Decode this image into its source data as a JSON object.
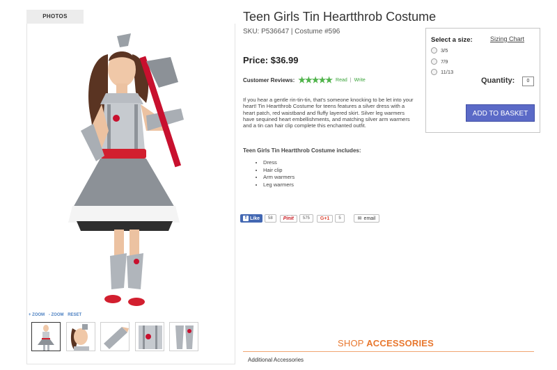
{
  "photos_tab": "PHOTOS",
  "zoom_controls": [
    "+ ZOOM",
    "- ZOOM",
    "RESET"
  ],
  "product": {
    "title": "Teen Girls Tin Heartthrob Costume",
    "sku": "SKU: P536647  |  Costume #596",
    "price": "Price: $36.99",
    "reviews_label": "Customer Reviews:",
    "stars": "★★★★★",
    "read": "Read",
    "write": "Write",
    "description": "If you hear a gentle rin-tin-tin, that's someone knocking to be let into your heart! Tin Heartthrob Costume for teens features a silver dress with a heart patch, red waistband and fluffy layered skirt. Silver leg warmers have sequined heart embellishments, and matching silver arm warmers and a tin can hair clip complete this enchanted outfit.",
    "includes_title": "Teen Girls Tin Heartthrob Costume includes:",
    "includes": [
      "Dress",
      "Hair clip",
      "Arm warmers",
      "Leg warmers"
    ]
  },
  "social": {
    "fb_label": "Like",
    "fb_count": "58",
    "pin_label": "Pinit",
    "pin_count": "575",
    "gplus_label": "G+1",
    "gplus_count": "5",
    "email_label": "email"
  },
  "purchase": {
    "select_size_label": "Select a size:",
    "sizing_chart": "Sizing Chart",
    "sizes": [
      "3/5",
      "7/9",
      "11/13"
    ],
    "quantity_label": "Quantity:",
    "quantity_value": "0",
    "add_button": "ADD TO BASKET"
  },
  "accessories": {
    "heading_prefix": "SHOP ",
    "heading_bold": "ACCESSORIES",
    "subheading": "Additional Accessories"
  },
  "colors": {
    "accent_orange": "#e8772e",
    "button_blue": "#5b6ac7",
    "star_green": "#4fb34a"
  }
}
